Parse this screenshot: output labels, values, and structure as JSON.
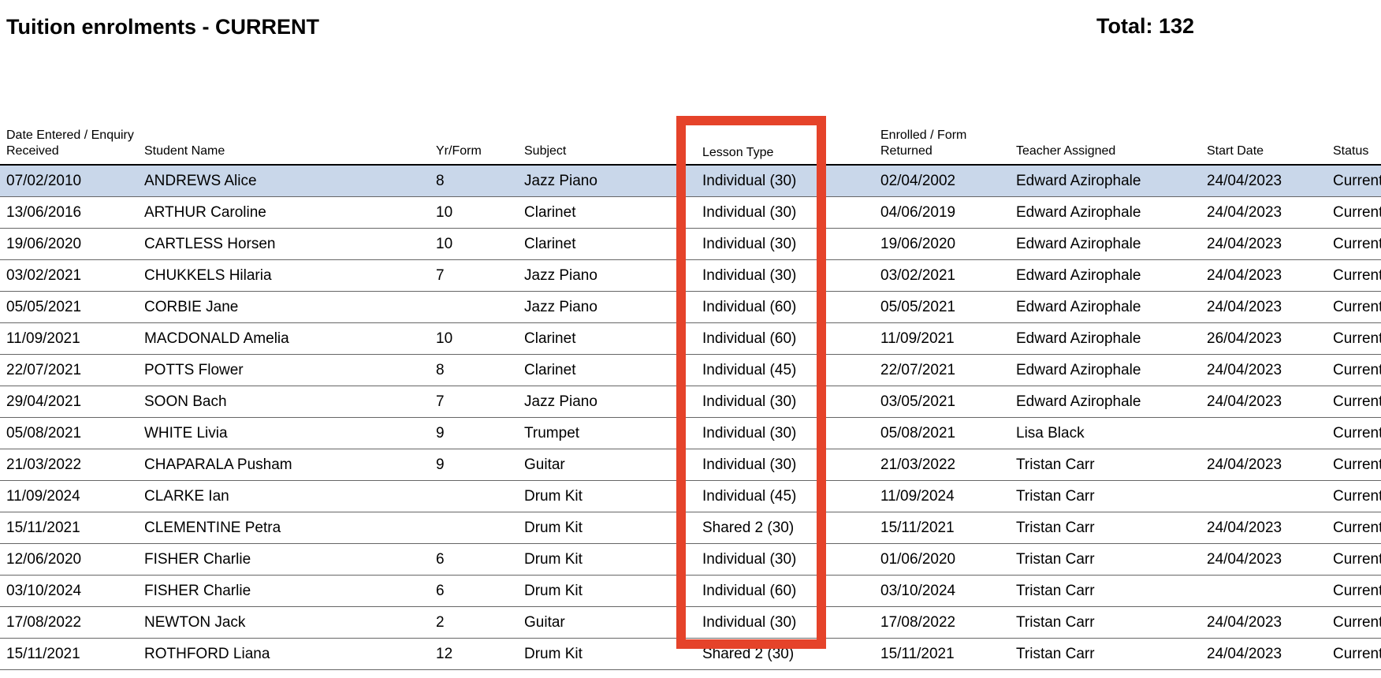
{
  "header": {
    "title": "Tuition enrolments - CURRENT",
    "total": "Total: 132"
  },
  "table": {
    "columns": [
      "Date Entered / Enquiry Received",
      "Student Name",
      "Yr/Form",
      "Subject",
      "Lesson Type",
      "Enrolled / Form Returned",
      "Teacher Assigned",
      "Start Date",
      "Status"
    ],
    "rows": [
      [
        "07/02/2010",
        "ANDREWS Alice",
        "8",
        "Jazz Piano",
        "Individual (30)",
        "02/04/2002",
        "Edward Azirophale",
        "24/04/2023",
        "Current"
      ],
      [
        "13/06/2016",
        "ARTHUR Caroline",
        "10",
        "Clarinet",
        "Individual (30)",
        "04/06/2019",
        "Edward Azirophale",
        "24/04/2023",
        "Current"
      ],
      [
        "19/06/2020",
        "CARTLESS Horsen",
        "10",
        "Clarinet",
        "Individual (30)",
        "19/06/2020",
        "Edward Azirophale",
        "24/04/2023",
        "Current"
      ],
      [
        "03/02/2021",
        "CHUKKELS Hilaria",
        "7",
        "Jazz Piano",
        "Individual (30)",
        "03/02/2021",
        "Edward Azirophale",
        "24/04/2023",
        "Current"
      ],
      [
        "05/05/2021",
        "CORBIE Jane",
        "",
        "Jazz Piano",
        "Individual (60)",
        "05/05/2021",
        "Edward Azirophale",
        "24/04/2023",
        "Current"
      ],
      [
        "11/09/2021",
        "MACDONALD Amelia",
        "10",
        "Clarinet",
        "Individual (60)",
        "11/09/2021",
        "Edward Azirophale",
        "26/04/2023",
        "Current"
      ],
      [
        "22/07/2021",
        "POTTS Flower",
        "8",
        "Clarinet",
        "Individual (45)",
        "22/07/2021",
        "Edward Azirophale",
        "24/04/2023",
        "Current"
      ],
      [
        "29/04/2021",
        "SOON Bach",
        "7",
        "Jazz Piano",
        "Individual (30)",
        "03/05/2021",
        "Edward Azirophale",
        "24/04/2023",
        "Current"
      ],
      [
        "05/08/2021",
        "WHITE Livia",
        "9",
        "Trumpet",
        "Individual (30)",
        "05/08/2021",
        "Lisa Black",
        "",
        "Current"
      ],
      [
        "21/03/2022",
        "CHAPARALA Pusham",
        "9",
        "Guitar",
        "Individual (30)",
        "21/03/2022",
        "Tristan Carr",
        "24/04/2023",
        "Current"
      ],
      [
        "11/09/2024",
        "CLARKE Ian",
        "",
        "Drum Kit",
        "Individual (45)",
        "11/09/2024",
        "Tristan Carr",
        "",
        "Current"
      ],
      [
        "15/11/2021",
        "CLEMENTINE Petra",
        "",
        "Drum Kit",
        "Shared 2 (30)",
        "15/11/2021",
        "Tristan Carr",
        "24/04/2023",
        "Current"
      ],
      [
        "12/06/2020",
        "FISHER Charlie",
        "6",
        "Drum Kit",
        "Individual (30)",
        "01/06/2020",
        "Tristan Carr",
        "24/04/2023",
        "Current"
      ],
      [
        "03/10/2024",
        "FISHER Charlie",
        "6",
        "Drum Kit",
        "Individual (60)",
        "03/10/2024",
        "Tristan Carr",
        "",
        "Current"
      ],
      [
        "17/08/2022",
        "NEWTON Jack",
        "2",
        "Guitar",
        "Individual (30)",
        "17/08/2022",
        "Tristan Carr",
        "24/04/2023",
        "Current"
      ],
      [
        "15/11/2021",
        "ROTHFORD Liana",
        "12",
        "Drum Kit",
        "Shared 2 (30)",
        "15/11/2021",
        "Tristan Carr",
        "24/04/2023",
        "Current"
      ]
    ]
  },
  "highlight": {
    "color": "#e5432a"
  },
  "colors": {
    "selected_row": "#c9d7ea"
  }
}
